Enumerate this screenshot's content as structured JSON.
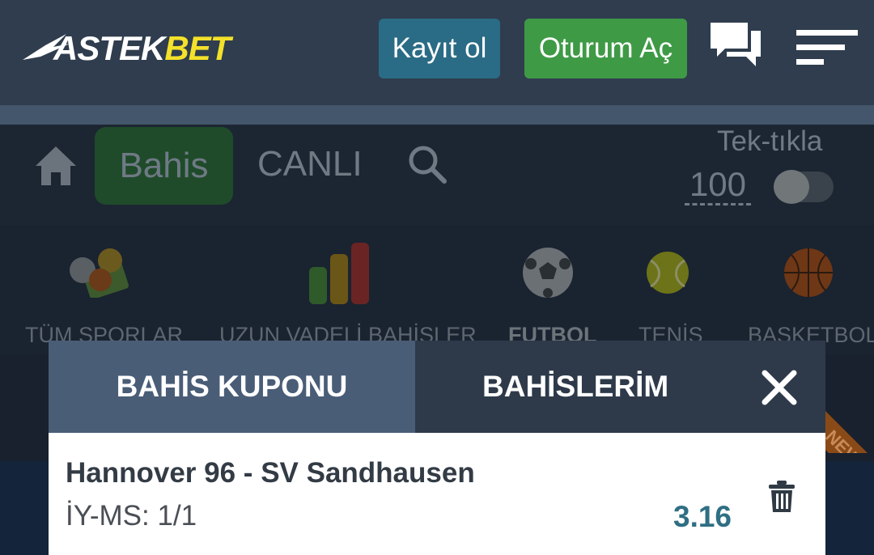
{
  "header": {
    "logo_part1": "ASTEK",
    "logo_part2": "BET",
    "register_label": "Kayıt ol",
    "login_label": "Oturum Aç",
    "icons": [
      "chat-icon",
      "menu-icon"
    ],
    "colors": {
      "register": "#2a6b85",
      "login": "#3f9a46",
      "logo_accent": "#f4e12a"
    }
  },
  "nav": {
    "tabs": [
      {
        "label": "Bahis",
        "active": true
      },
      {
        "label": "CANLI",
        "active": false
      }
    ],
    "icons": [
      "home-icon",
      "search-icon"
    ],
    "one_click": {
      "label": "Tek-tıkla",
      "stake": "100",
      "enabled": false
    }
  },
  "sports": {
    "items": [
      {
        "label": "TÜM SPORLAR",
        "icon": "all-sports-icon"
      },
      {
        "label": "UZUN VADELİ BAHİSLER",
        "icon": "bar-chart-icon"
      },
      {
        "label": "FUTBOL",
        "icon": "football-icon"
      },
      {
        "label": "TENİS",
        "icon": "tennis-ball-icon"
      },
      {
        "label": "BASKETBOL",
        "icon": "basketball-icon"
      }
    ],
    "new_badge": "NEW"
  },
  "betslip": {
    "tabs": [
      {
        "label": "BAHİS KUPONU",
        "active": true
      },
      {
        "label": "BAHİSLERİM",
        "active": false
      }
    ],
    "selection": {
      "event": "Hannover 96 - SV Sandhausen",
      "market": "İY-MS: 1/1",
      "odds": "3.16"
    },
    "colors": {
      "active_tab": "#4a5d77",
      "odds": "#2f6f84"
    }
  }
}
